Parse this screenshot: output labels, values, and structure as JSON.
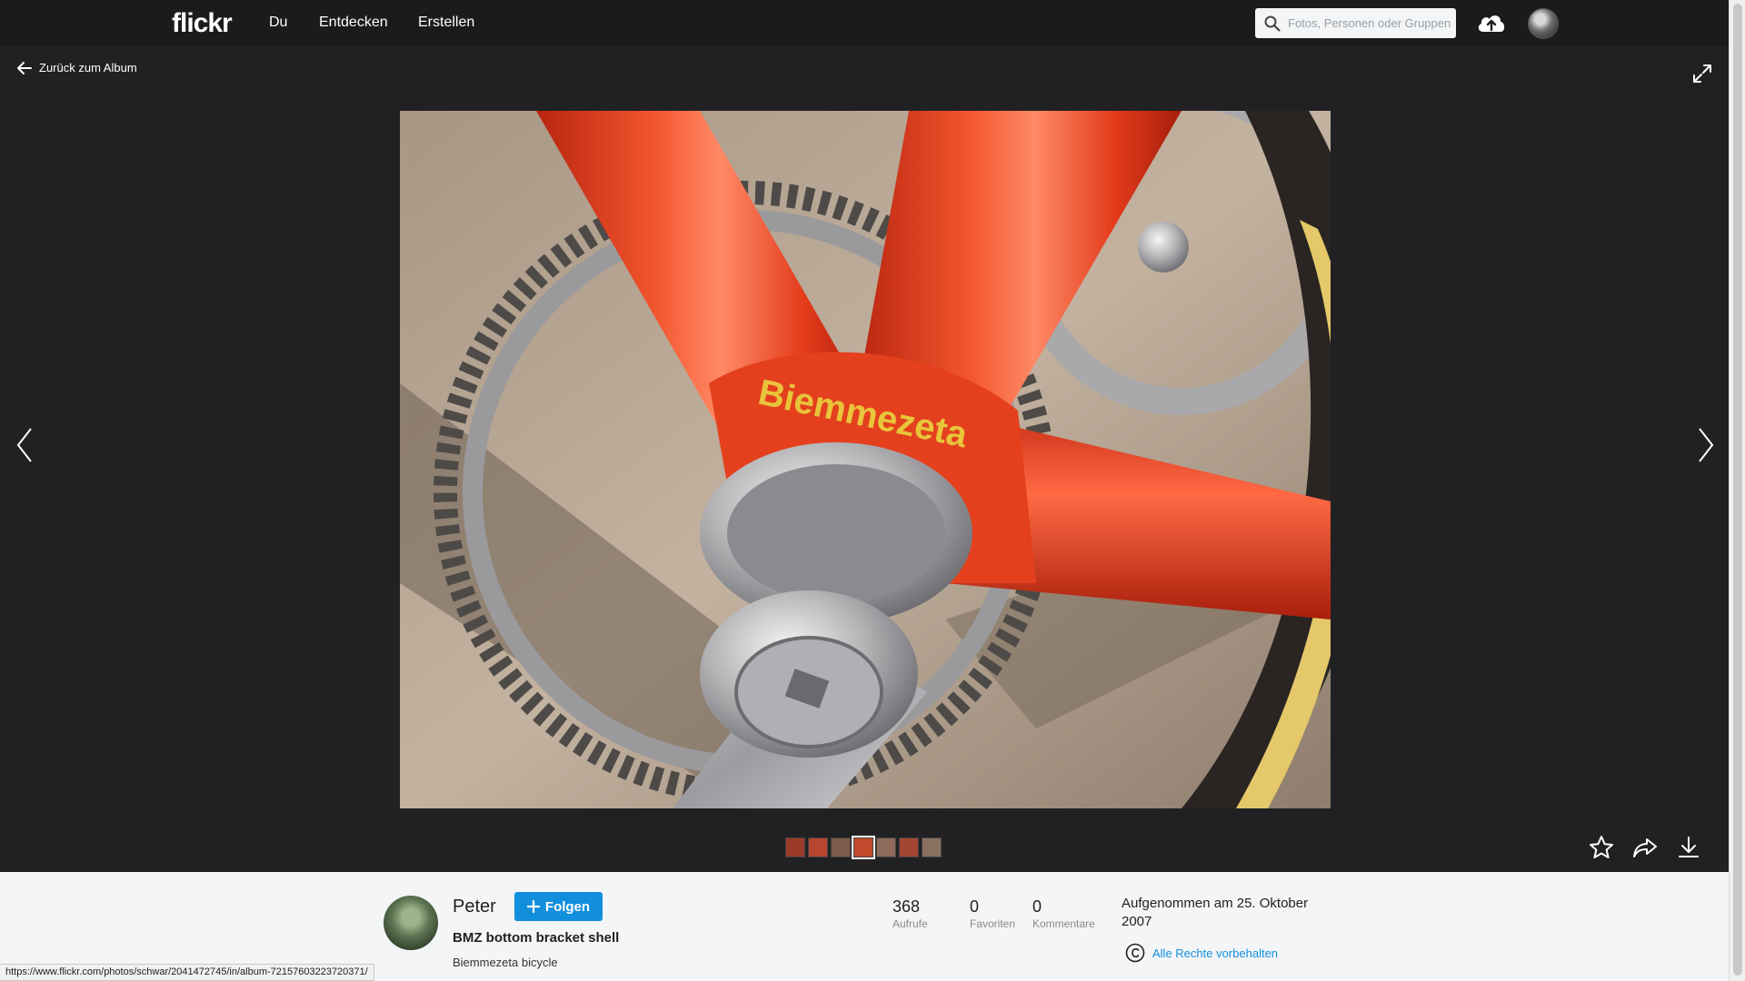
{
  "nav": {
    "logo": "flickr",
    "links": [
      "Du",
      "Entdecken",
      "Erstellen"
    ],
    "search_placeholder": "Fotos, Personen oder Gruppen",
    "icons": {
      "search": "search-icon",
      "upload": "cloud-upload-icon"
    }
  },
  "viewer": {
    "back_label": "Zurück zum Album",
    "photo_brand_text": "Biemmezeta",
    "thumbnail_count": 7,
    "active_thumbnail": 4,
    "actions": [
      "star-icon",
      "share-icon",
      "download-icon"
    ],
    "colors": {
      "frame": "#e8361c",
      "decal": "#e8c53a"
    }
  },
  "info": {
    "owner": "Peter",
    "follow_label": "Folgen",
    "title": "BMZ bottom bracket shell",
    "description": "Biemmezeta bicycle",
    "stats": [
      {
        "value": "368",
        "label": "Aufrufe"
      },
      {
        "value": "0",
        "label": "Favoriten"
      },
      {
        "value": "0",
        "label": "Kommentare"
      }
    ],
    "taken": "Aufgenommen am 25. Oktober 2007",
    "license": "Alle Rechte vorbehalten",
    "accent": "#128fdc"
  },
  "statusbar_url": "https://www.flickr.com/photos/schwar/2041472745/in/album-72157603223720371/"
}
